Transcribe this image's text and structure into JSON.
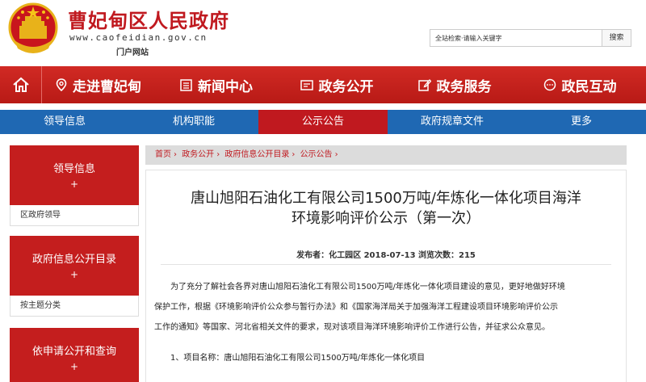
{
  "header": {
    "site_title": "曹妃甸区人民政府",
    "site_url": "www.caofeidian.gov.cn",
    "site_subtitle": "门户网站",
    "search_placeholder": "全站检索·请输入关键字",
    "search_button": "搜索"
  },
  "main_nav": {
    "items": [
      {
        "label": "走进曹妃甸",
        "icon": "location-pin-icon"
      },
      {
        "label": "新闻中心",
        "icon": "news-list-icon"
      },
      {
        "label": "政务公开",
        "icon": "mail-document-icon"
      },
      {
        "label": "政务服务",
        "icon": "edit-icon"
      },
      {
        "label": "政民互动",
        "icon": "chat-bubble-icon"
      }
    ]
  },
  "sub_nav": {
    "items": [
      "领导信息",
      "机构职能",
      "公示公告",
      "政府规章文件",
      "更多"
    ],
    "active_index": 2
  },
  "sidebar": {
    "sections": [
      {
        "title": "领导信息",
        "plus": "+",
        "link": "区政府领导"
      },
      {
        "title": "政府信息公开目录",
        "plus": "+",
        "link": "按主题分类"
      },
      {
        "title": "依申请公开和查询",
        "plus": "+"
      }
    ]
  },
  "breadcrumb": [
    "首页",
    "政务公开",
    "政府信息公开目录",
    "公示公告"
  ],
  "article": {
    "title_line1": "唐山旭阳石油化工有限公司1500万吨/年炼化一体化项目海洋",
    "title_line2": "环境影响评价公示（第一次）",
    "meta": "发布者：化工园区  2018-07-13  浏览次数：215",
    "para1_line1": "为了充分了解社会各界对唐山旭阳石油化工有限公司1500万吨/年炼化一体化项目建设的意见，更好地做好环境",
    "para1_line2": "保护工作，根据《环境影响评价公众参与暂行办法》和《国家海洋局关于加强海洋工程建设项目环境影响评价公示",
    "para1_line3": "工作的通知》等国家、河北省相关文件的要求，现对该项目海洋环境影响评价工作进行公告，并征求公众意见。",
    "para2": "1、项目名称：唐山旭阳石油化工有限公司1500万吨/年炼化一体化项目"
  },
  "colors": {
    "brand_red": "#c0191f",
    "nav_blue": "#1f68b3",
    "gold": "#f5c518"
  }
}
